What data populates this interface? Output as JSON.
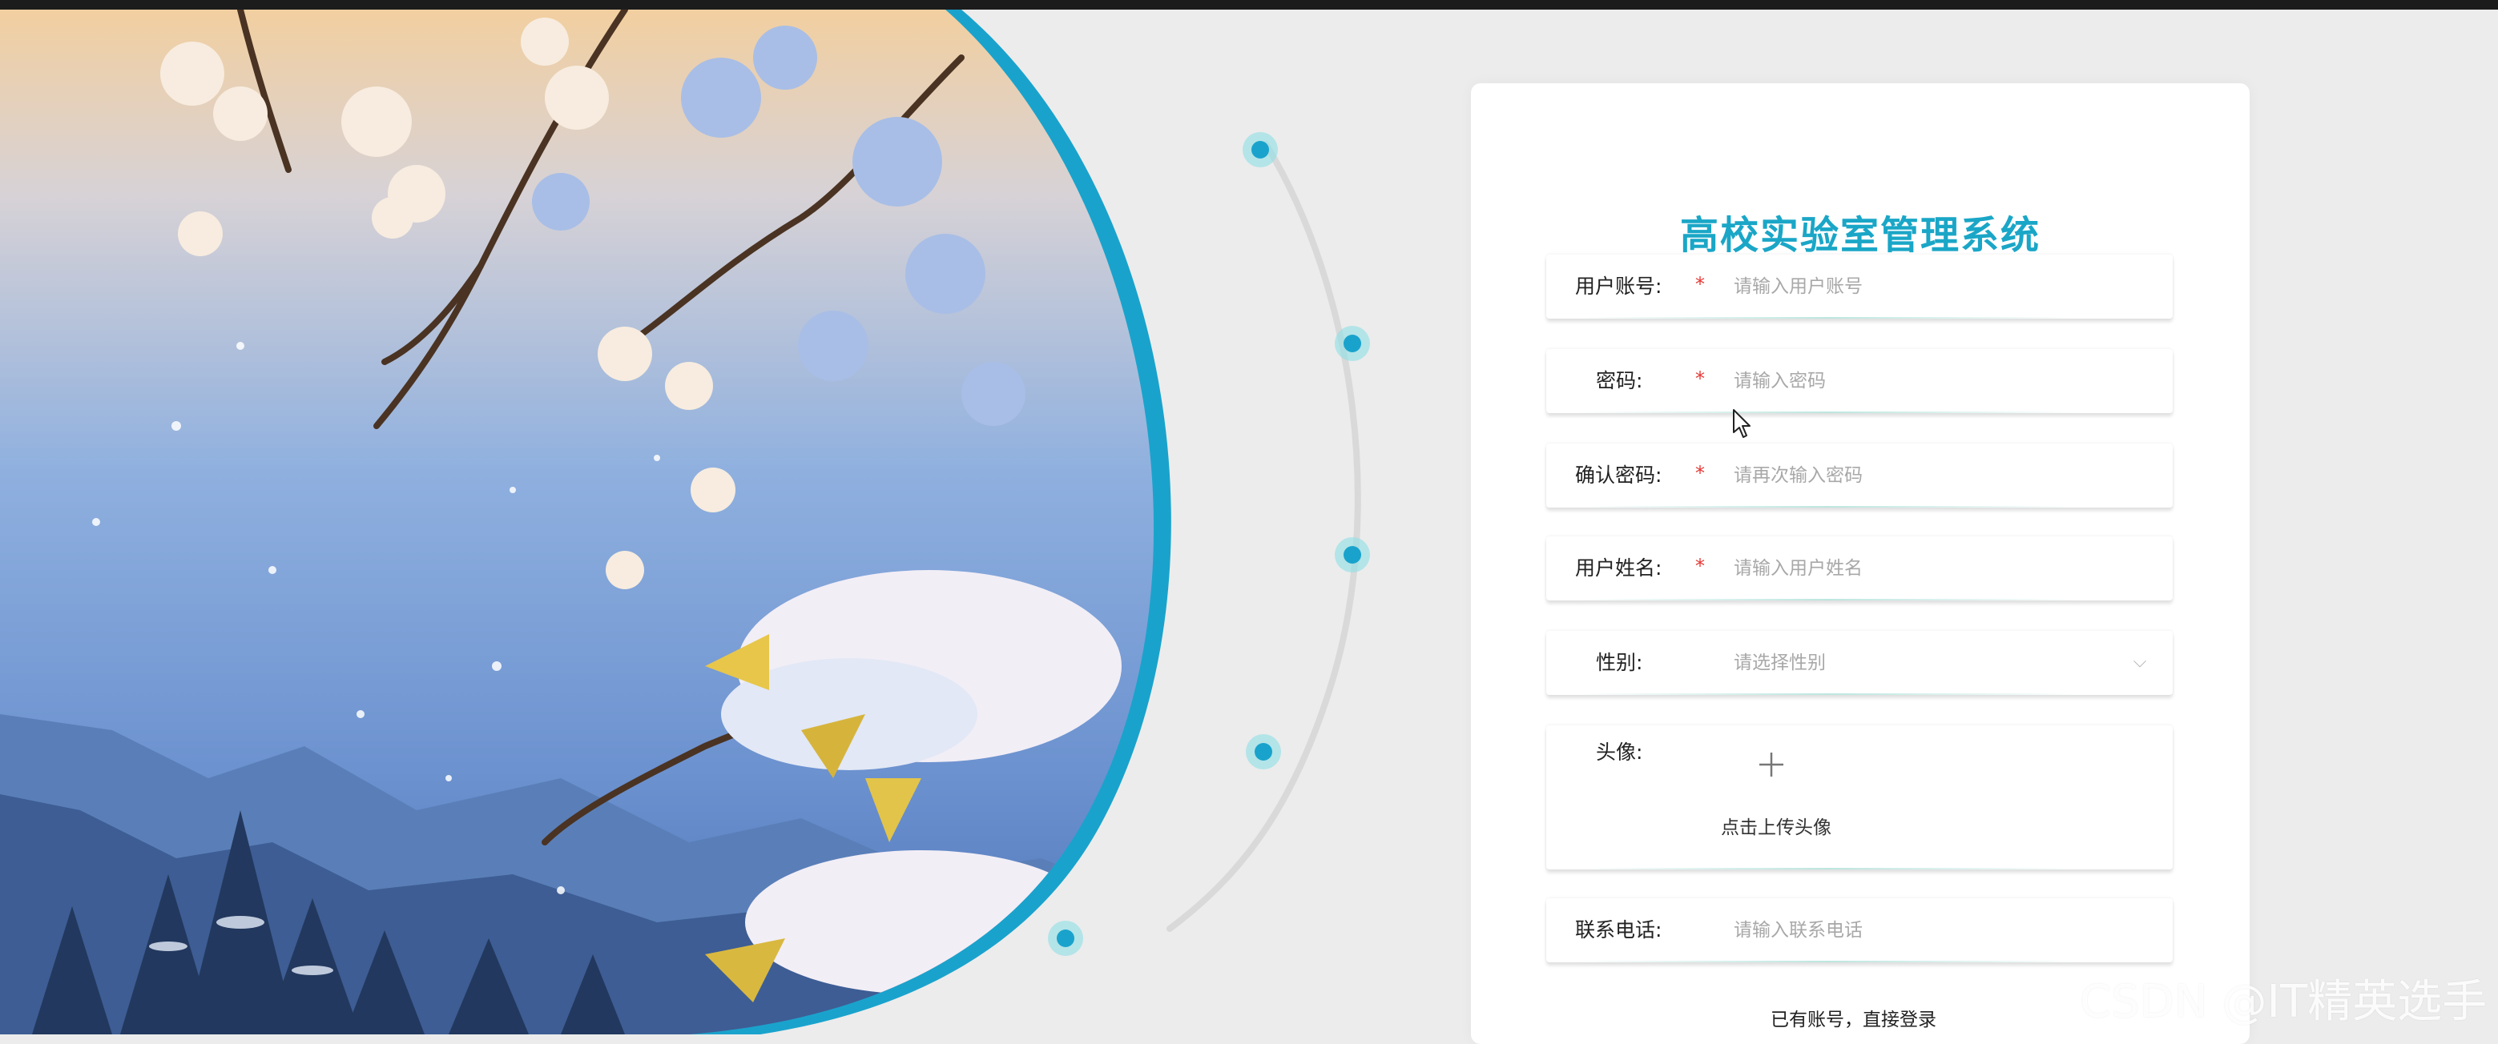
{
  "app": {
    "title": "高校实验室管理系统"
  },
  "form": {
    "fields": [
      {
        "label": "用户账号:",
        "required": "*",
        "placeholder": "请输入用户账号"
      },
      {
        "label": "密码:",
        "required": "*",
        "placeholder": "请输入密码"
      },
      {
        "label": "确认密码:",
        "required": "*",
        "placeholder": "请再次输入密码"
      },
      {
        "label": "用户姓名:",
        "required": "*",
        "placeholder": "请输入用户姓名"
      },
      {
        "label": "性别:",
        "placeholder": "请选择性别"
      },
      {
        "label": "头像:",
        "upload_text": "点击上传头像"
      },
      {
        "label": "联系电话:",
        "placeholder": "请输入联系电话"
      }
    ],
    "login_link": "已有账号，直接登录"
  },
  "watermark": "CSDN @IT精英选手",
  "colors": {
    "accent": "#1aa6c7",
    "required": "#e53935",
    "ring": "#19a3cc"
  },
  "icons": {
    "select": "chevron-down-icon",
    "upload": "plus-icon",
    "pointer": "cursor-icon"
  }
}
